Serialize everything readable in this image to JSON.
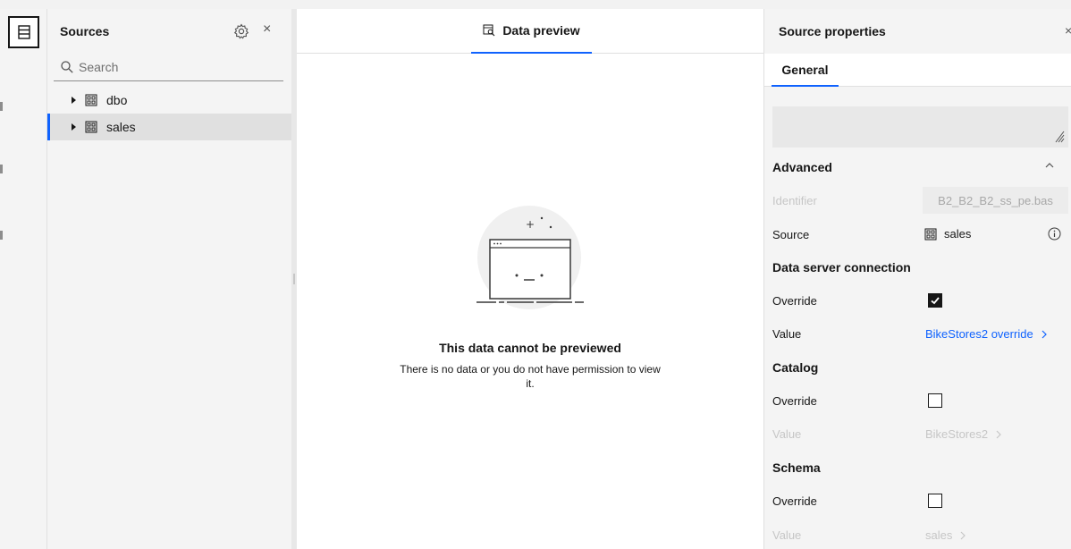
{
  "sources": {
    "title": "Sources",
    "search_placeholder": "Search",
    "items": [
      {
        "label": "dbo",
        "selected": false
      },
      {
        "label": "sales",
        "selected": true
      }
    ]
  },
  "center": {
    "tab_label": "Data preview",
    "empty_title": "This data cannot be previewed",
    "empty_message": "There is no data or you do not have permission to view it."
  },
  "properties": {
    "title": "Source properties",
    "tab_label": "General",
    "advanced_label": "Advanced",
    "identifier_label": "Identifier",
    "identifier_value": "B2_B2_B2_ss_pe.bas",
    "source_label": "Source",
    "source_value": "sales",
    "data_server": {
      "heading": "Data server connection",
      "override_label": "Override",
      "override_checked": true,
      "value_label": "Value",
      "value": "BikeStores2 override"
    },
    "catalog": {
      "heading": "Catalog",
      "override_label": "Override",
      "override_checked": false,
      "value_label": "Value",
      "value": "BikeStores2"
    },
    "schema": {
      "heading": "Schema",
      "override_label": "Override",
      "override_checked": false,
      "value_label": "Value",
      "value": "sales"
    }
  },
  "colors": {
    "accent": "#0f62fe",
    "panel_bg": "#f4f4f4",
    "selected_bg": "#e0e0e0"
  },
  "icons": {
    "rail": "data-source-icon",
    "settings": "gear-icon",
    "close": "close-icon",
    "search": "search-icon",
    "schema": "schema-icon",
    "preview": "data-preview-icon",
    "info": "info-icon"
  }
}
